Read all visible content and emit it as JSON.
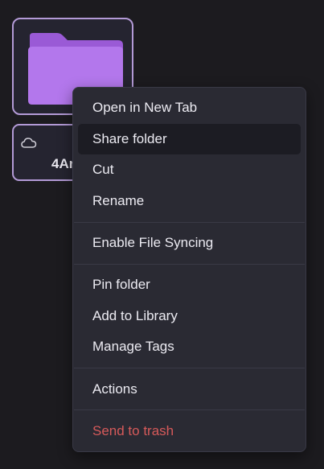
{
  "file": {
    "name": "4Ar",
    "folder_color": "#b377ec",
    "folder_tab_color": "#9a5ad6",
    "selection_border": "#b39ad6",
    "cloud_icon": "cloud-icon"
  },
  "context_menu": {
    "items": [
      {
        "label": "Open in New Tab"
      },
      {
        "label": "Share folder",
        "highlighted": true
      },
      {
        "label": "Cut"
      },
      {
        "label": "Rename"
      },
      {
        "label": "Enable File Syncing"
      },
      {
        "label": "Pin folder"
      },
      {
        "label": "Add to Library"
      },
      {
        "label": "Manage Tags"
      },
      {
        "label": "Actions"
      },
      {
        "label": "Send to trash",
        "color": "#d65a5a"
      }
    ]
  }
}
